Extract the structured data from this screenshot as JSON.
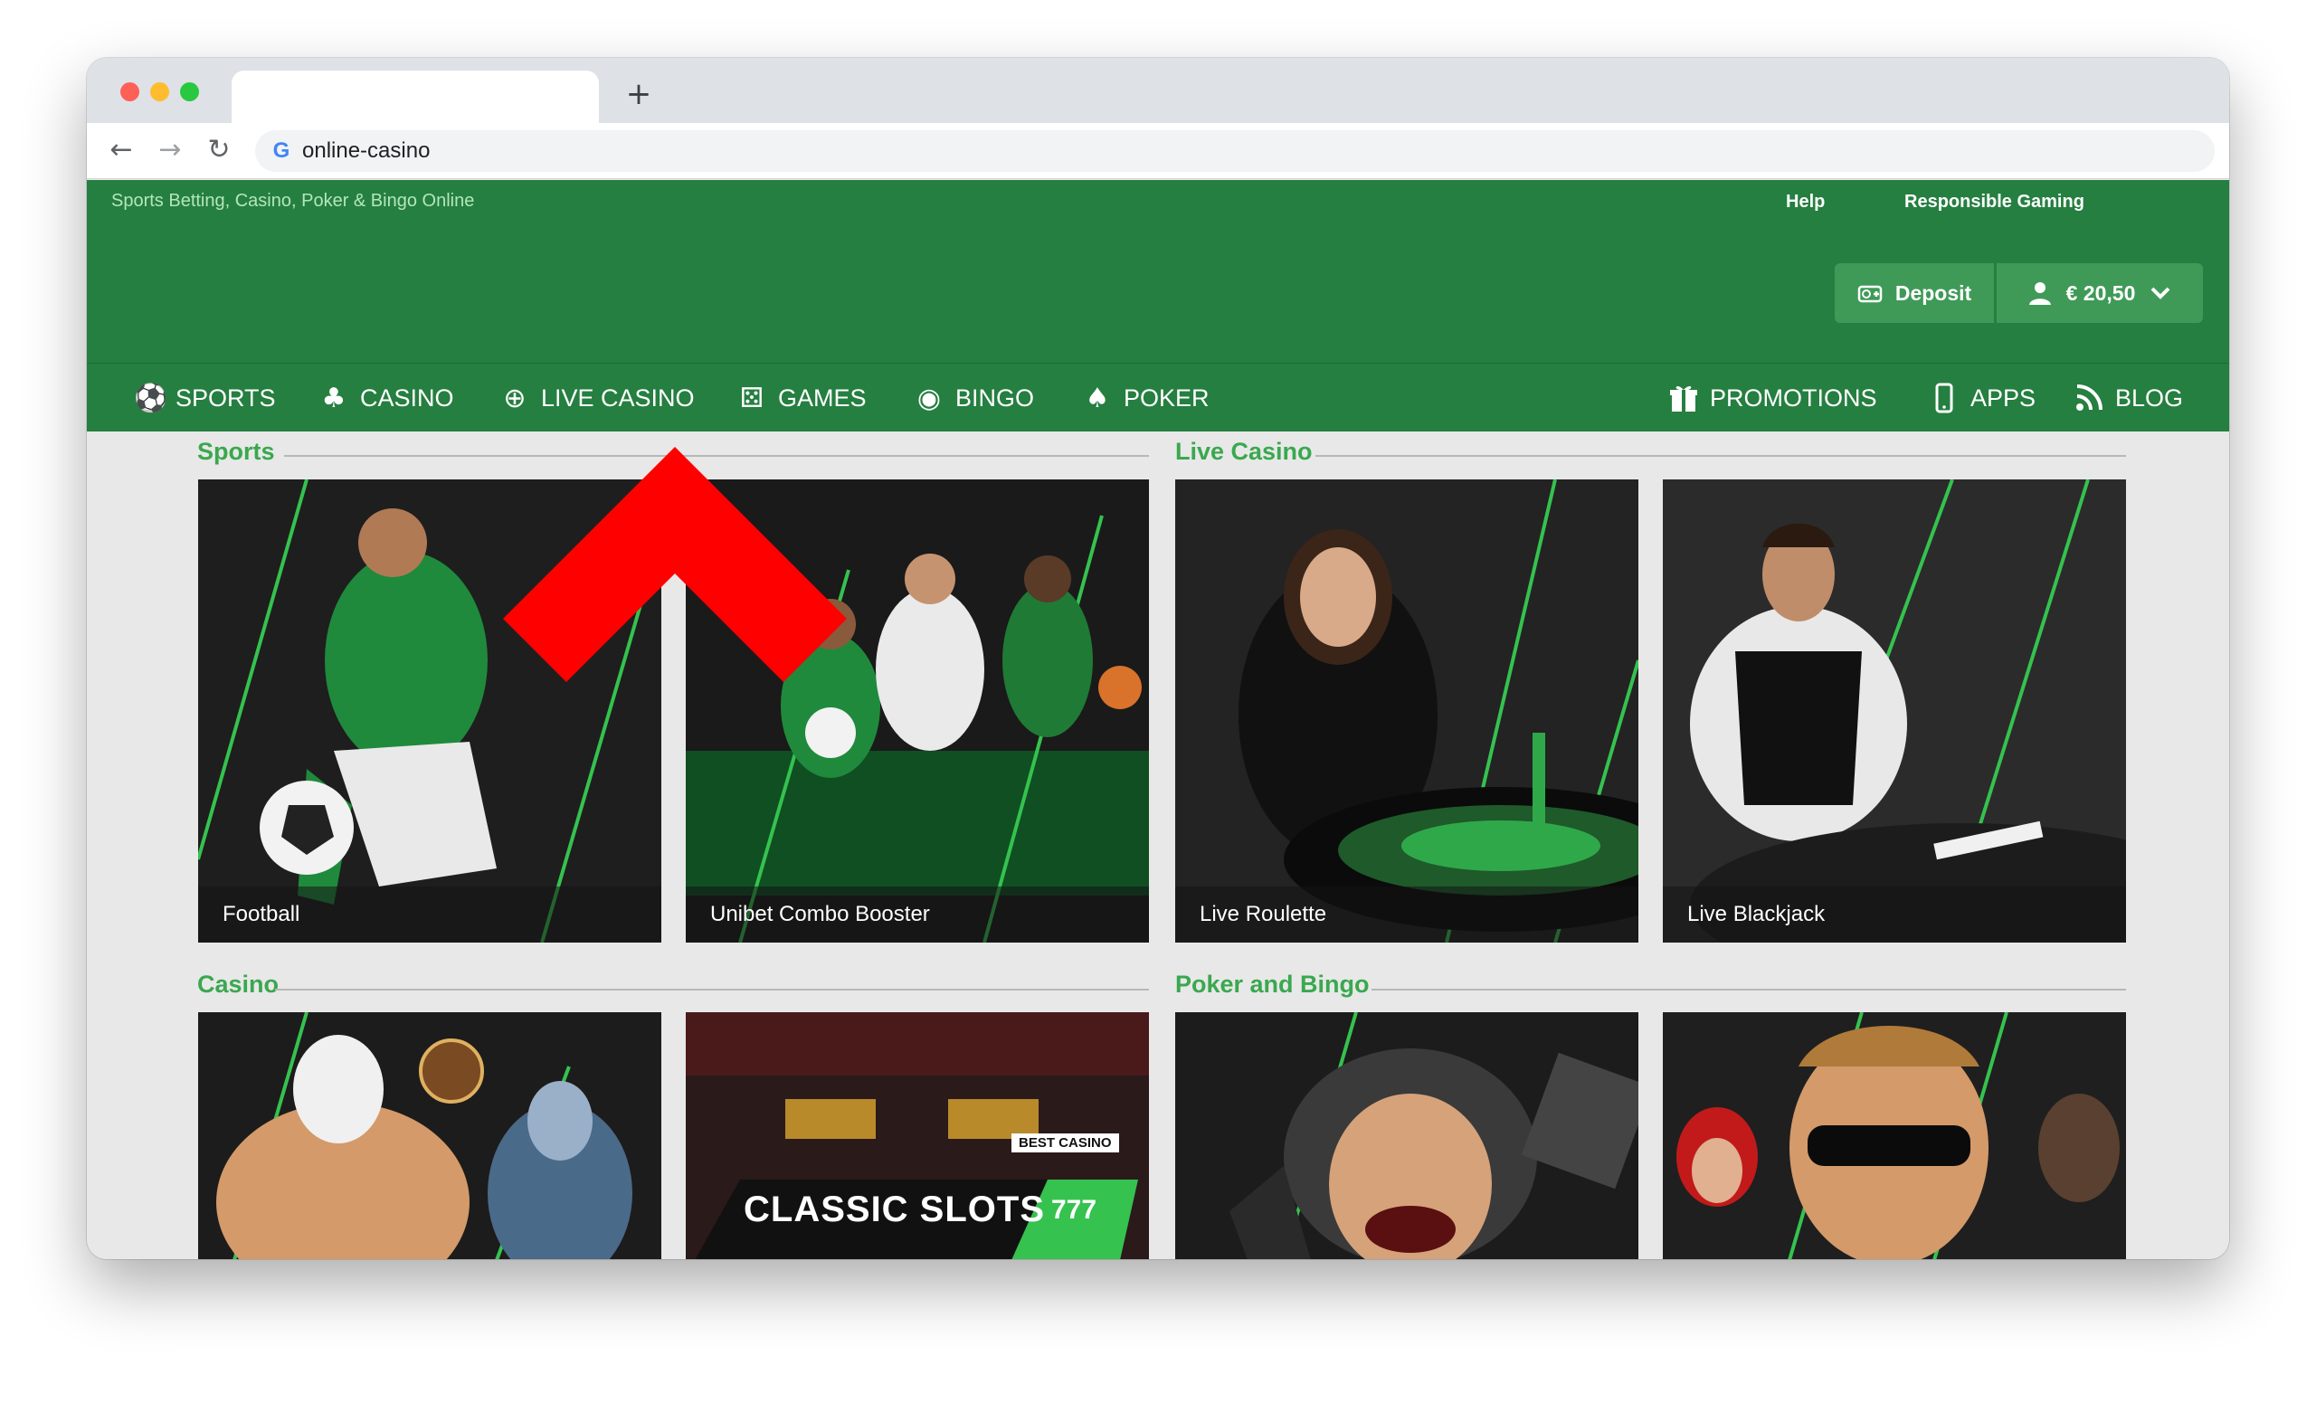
{
  "browser": {
    "url": "online-casino",
    "new_tab_glyph": "+",
    "back_glyph": "←",
    "forward_glyph": "→",
    "reload_glyph": "↻",
    "search_engine_glyph": "G"
  },
  "header": {
    "tagline": "Sports Betting, Casino, Poker & Bingo Online",
    "links": {
      "help": "Help",
      "responsible_gaming": "Responsible Gaming"
    },
    "deposit_label": "Deposit",
    "balance": "€ 20,50"
  },
  "nav": {
    "left": [
      {
        "label": "SPORTS",
        "icon": "sports-ball-icon"
      },
      {
        "label": "CASINO",
        "icon": "casino-chip-icon"
      },
      {
        "label": "LIVE CASINO",
        "icon": "live-casino-icon"
      },
      {
        "label": "GAMES",
        "icon": "dice-icon"
      },
      {
        "label": "BINGO",
        "icon": "bingo-ball-icon"
      },
      {
        "label": "POKER",
        "icon": "poker-card-icon"
      }
    ],
    "right": [
      {
        "label": "PROMOTIONS",
        "icon": "gift-icon"
      },
      {
        "label": "APPS",
        "icon": "phone-icon"
      },
      {
        "label": "BLOG",
        "icon": "rss-icon"
      }
    ]
  },
  "sections": {
    "sports": {
      "title": "Sports",
      "cards": [
        "Football",
        "Unibet Combo Booster"
      ]
    },
    "live_casino": {
      "title": "Live Casino",
      "cards": [
        "Live Roulette",
        "Live Blackjack"
      ]
    },
    "casino": {
      "title": "Casino",
      "cards": [
        "",
        ""
      ],
      "slots_banner": "CLASSIC SLOTS",
      "slots_badge": "BEST CASINO",
      "slots_symbols": "777"
    },
    "poker_bingo": {
      "title": "Poker and Bingo",
      "cards": [
        "",
        ""
      ]
    }
  },
  "colors": {
    "brand_green": "#257f40",
    "accent_green": "#3aa84f",
    "button_green": "#3f9a58",
    "overlay_arrow": "#ff0000"
  }
}
